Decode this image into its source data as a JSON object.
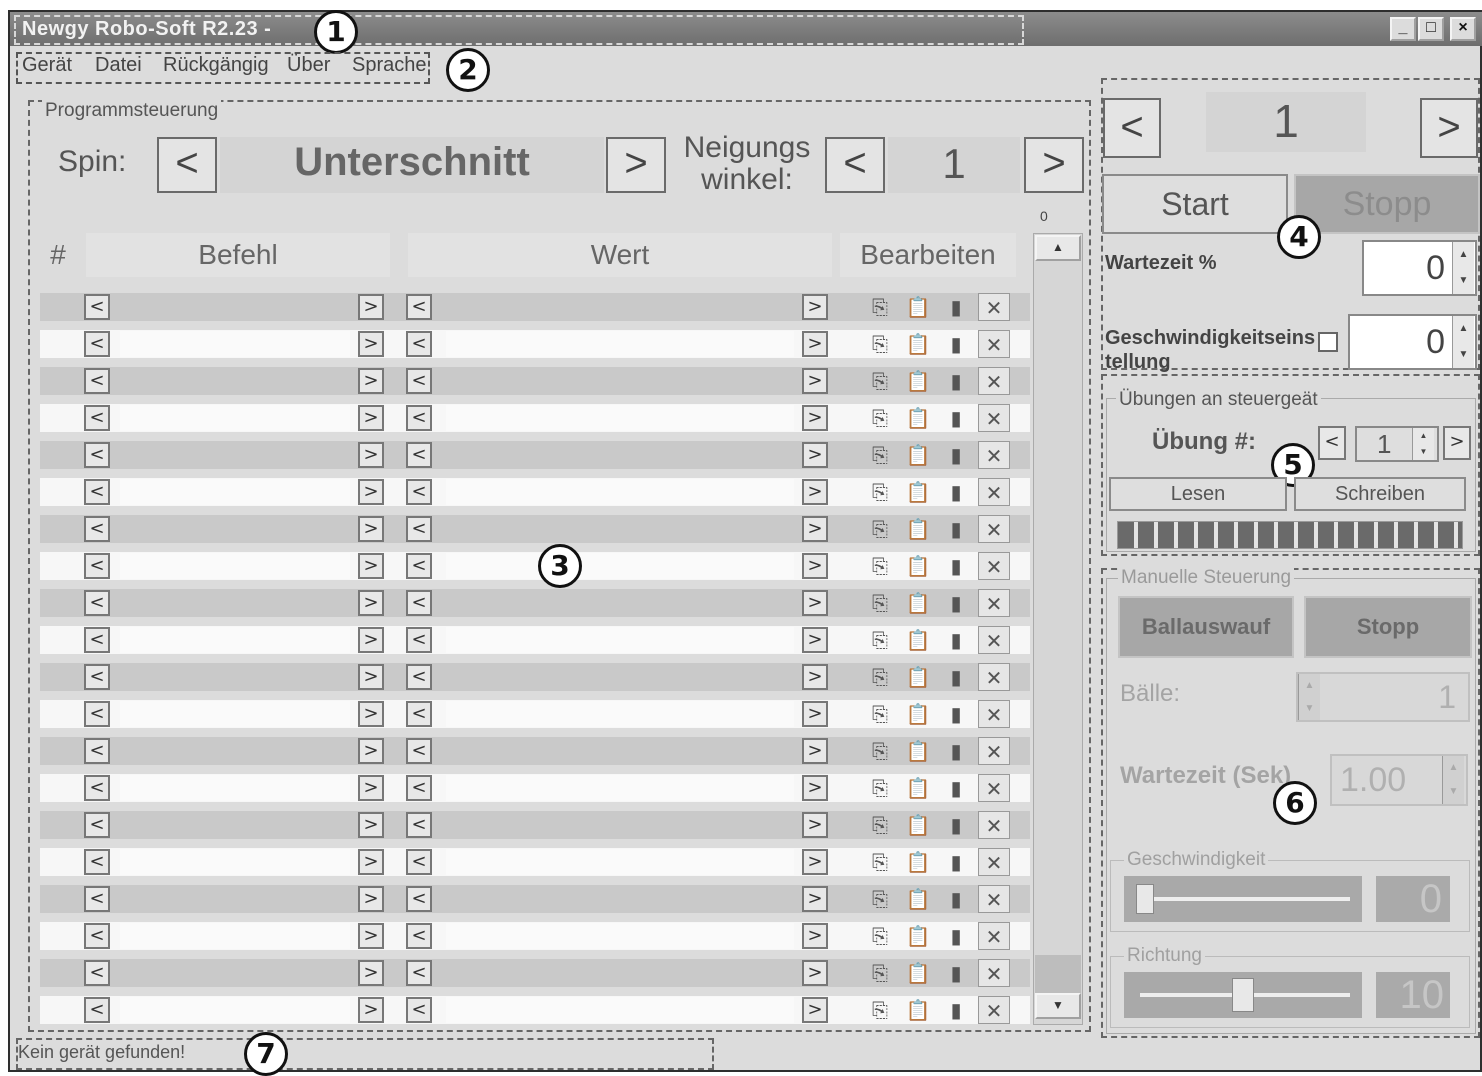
{
  "window": {
    "title": "Newgy Robo-Soft R2.23 -",
    "controls": [
      "_",
      "□",
      "×"
    ]
  },
  "menu": {
    "items": [
      "Gerät",
      "Datei",
      "Rückgängig",
      "Über",
      "Sprache"
    ]
  },
  "callouts": [
    "1",
    "2",
    "3",
    "4",
    "5",
    "6",
    "7"
  ],
  "program": {
    "group_title": "Programmsteuerung",
    "spin_label": "Spin:",
    "spin_value": "Unterschnitt",
    "tilt_label_line1": "Neigungs",
    "tilt_label_line2": "winkel:",
    "tilt_value": "1",
    "prev": "<",
    "next": ">",
    "scroll_value": "0",
    "headers": {
      "num": "#",
      "command": "Befehl",
      "value": "Wert",
      "edit": "Bearbeiten"
    },
    "row_count": 20
  },
  "control": {
    "prev": "<",
    "next": ">",
    "program_number": "1",
    "start_label": "Start",
    "stop_label": "Stopp",
    "wait_label": "Wartezeit %",
    "wait_value": "0",
    "speed_label": "Geschwindigkeitseinstellung",
    "speed_value": "0"
  },
  "exercises": {
    "group_title": "Übungen an steuergeät",
    "exercise_label": "Übung #:",
    "exercise_value": "1",
    "read_label": "Lesen",
    "write_label": "Schreiben"
  },
  "manual": {
    "group_title": "Manuelle Steuerung",
    "feed_label": "Ballauswauf",
    "stop_label": "Stopp",
    "balls_label": "Bälle:",
    "balls_value": "1",
    "wait_label": "Wartezeit (Sek)",
    "wait_value": "1.00",
    "speed_group": "Geschwindigkeit",
    "speed_value": "0",
    "direction_group": "Richtung",
    "direction_value": "10"
  },
  "status": {
    "text": "Kein gerät gefunden!"
  }
}
